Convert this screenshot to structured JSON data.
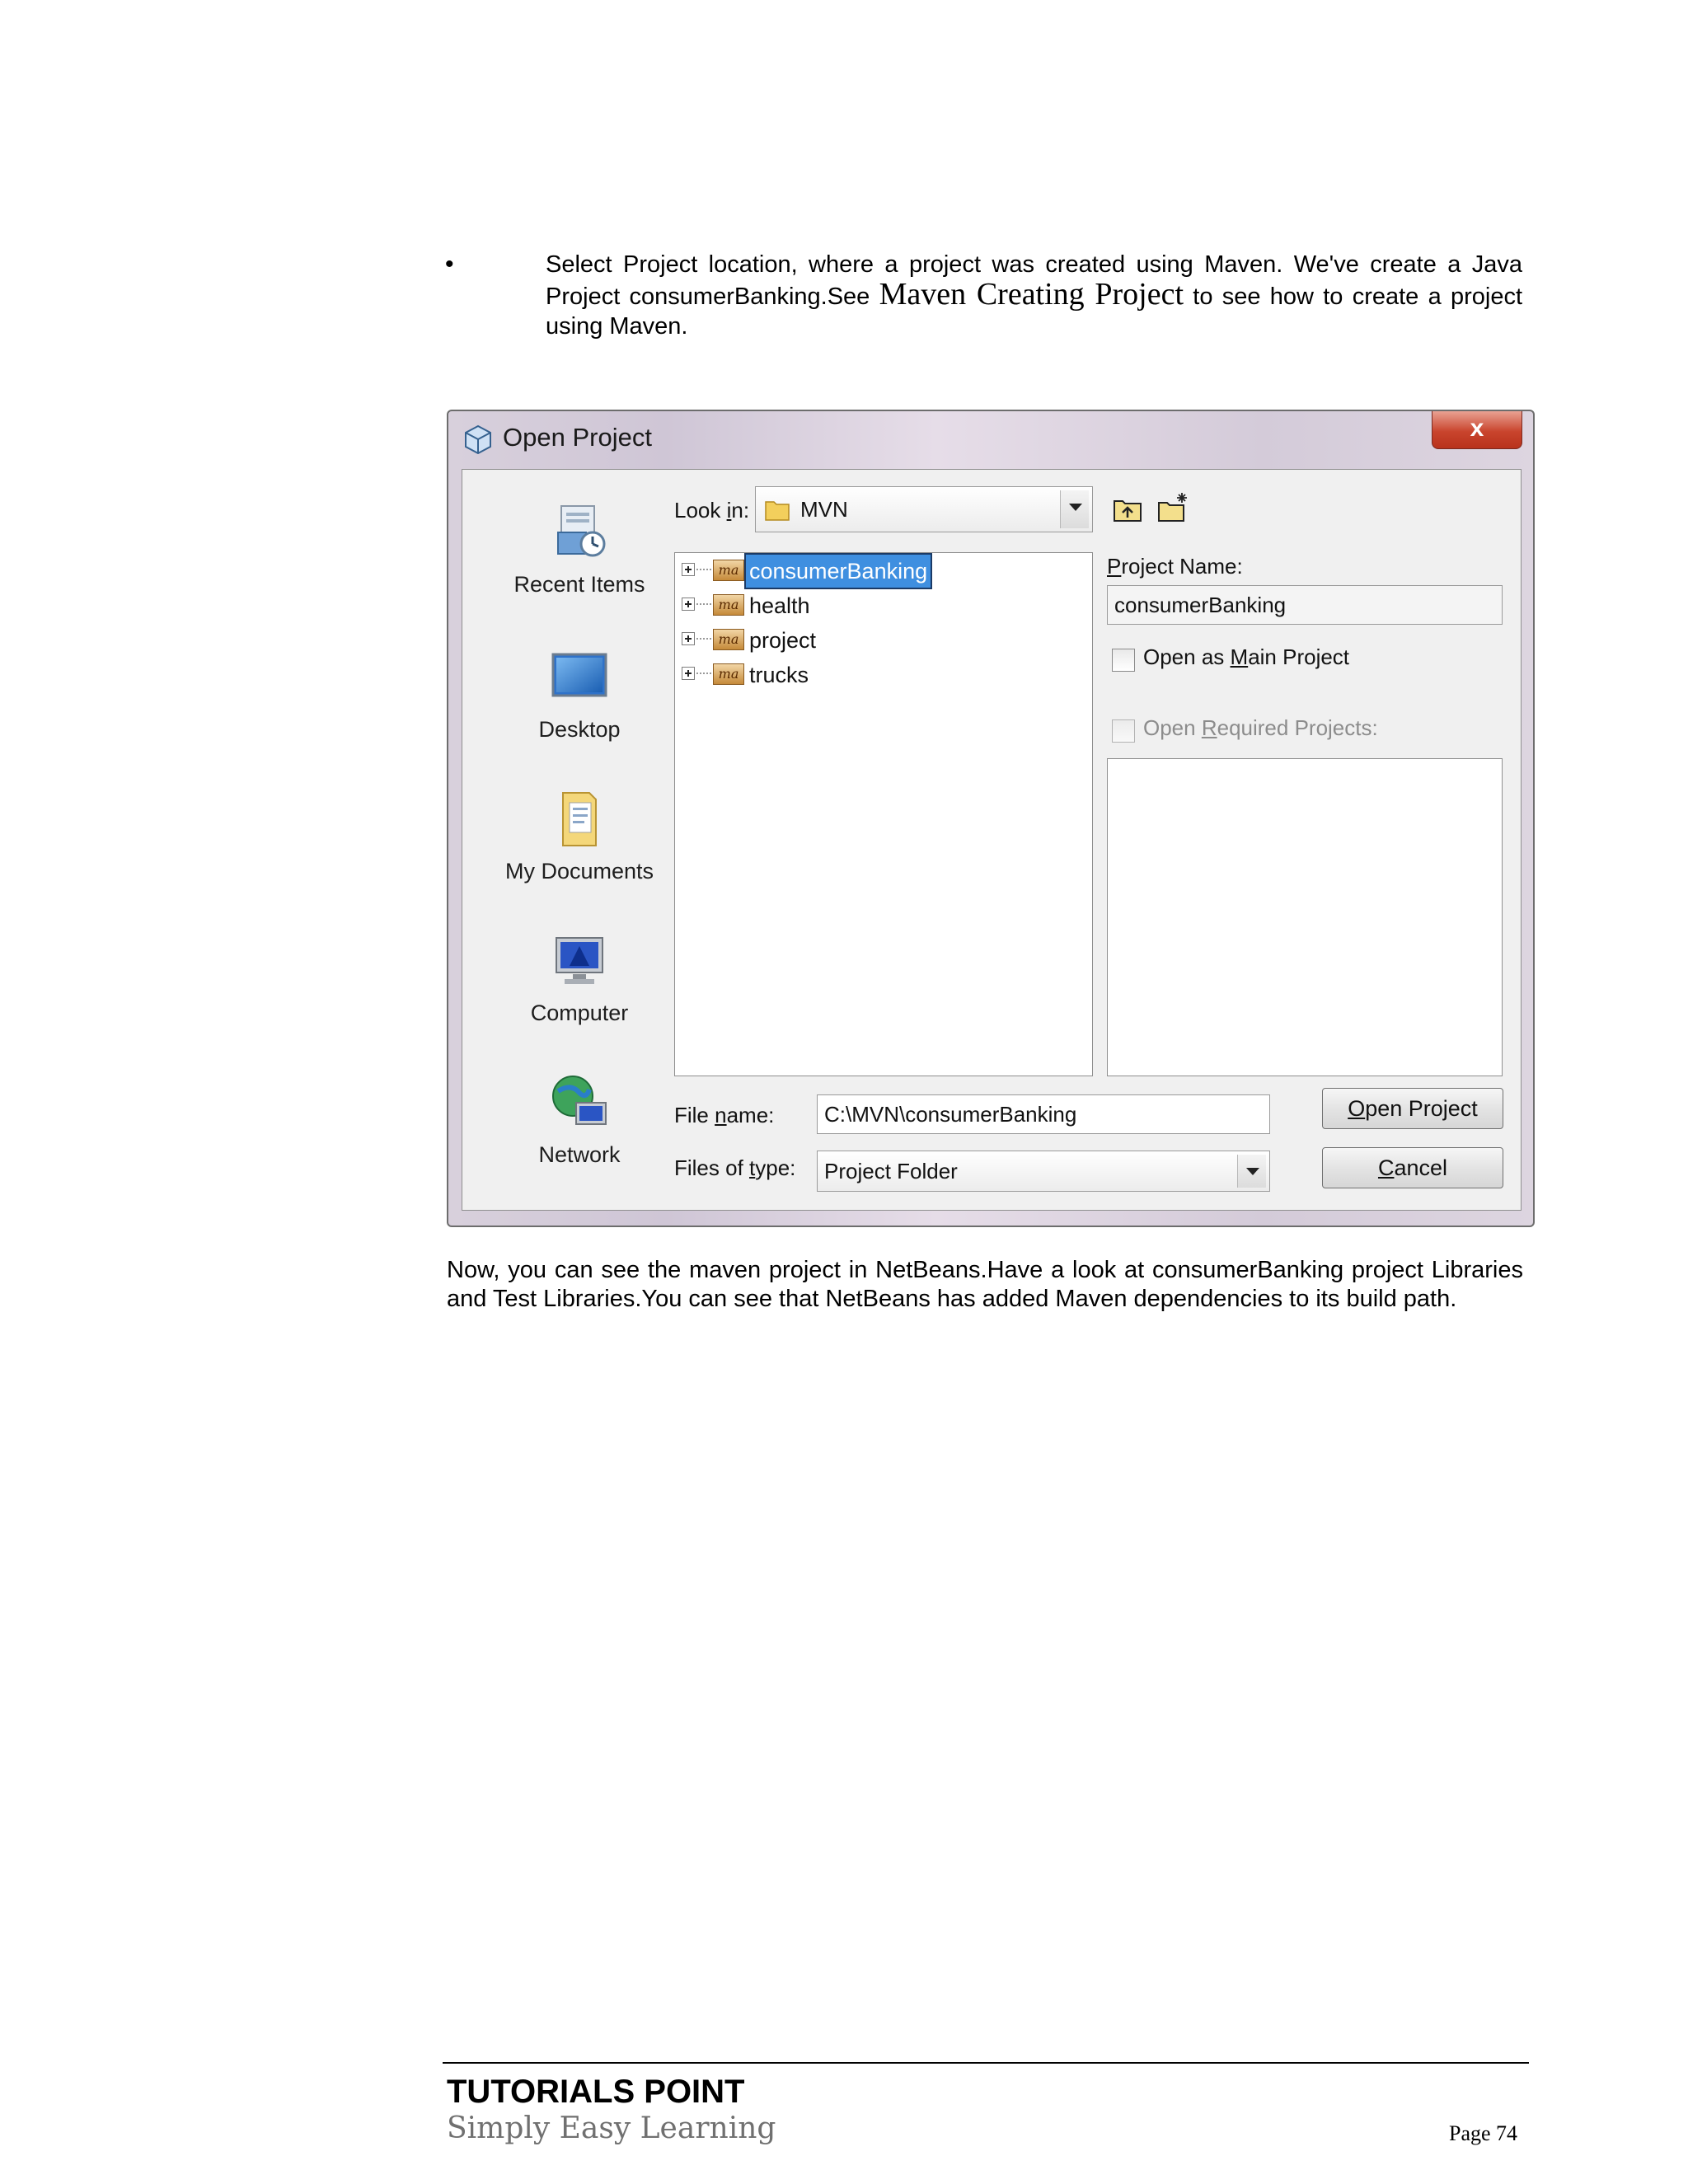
{
  "intro": {
    "bullet": "•",
    "text_before": "Select Project location, where a project was created using Maven. We've create a Java Project consumerBanking.See ",
    "link_text": "Maven Creating Project",
    "text_after": " to see how to create a project using Maven."
  },
  "dialog": {
    "title": "Open Project",
    "close_label": "x",
    "places": [
      {
        "label": "Recent Items",
        "icon": "recent-items-icon"
      },
      {
        "label": "Desktop",
        "icon": "desktop-icon"
      },
      {
        "label": "My Documents",
        "icon": "documents-folder-icon"
      },
      {
        "label": "Computer",
        "icon": "computer-icon"
      },
      {
        "label": "Network",
        "icon": "network-icon"
      }
    ],
    "look_in": {
      "label_pre": "Look ",
      "label_u": "i",
      "label_post": "n:",
      "value": "MVN"
    },
    "tree_items": [
      "consumerBanking",
      "health",
      "project",
      "trucks"
    ],
    "selected_item": "consumerBanking",
    "project_name": {
      "label_u": "P",
      "label_post": "roject Name:",
      "value": "consumerBanking"
    },
    "open_as_main": {
      "pre": "Open as ",
      "u": "M",
      "post": "ain Project",
      "checked": false
    },
    "open_required": {
      "pre": "Open ",
      "u": "R",
      "post": "equired Projects:",
      "checked": false,
      "enabled": false
    },
    "file_name": {
      "pre": "File ",
      "u": "n",
      "post": "ame:",
      "value": "C:\\MVN\\consumerBanking"
    },
    "files_of_type": {
      "pre": "Files of ",
      "u": "t",
      "post": "ype:",
      "value": "Project Folder"
    },
    "open_button": {
      "u": "O",
      "post": "pen Project"
    },
    "cancel_button": {
      "u": "C",
      "post": "ancel"
    }
  },
  "outro": {
    "text": "Now, you can see the maven project in NetBeans.Have a look at consumerBanking project Libraries and Test Libraries.You can see that NetBeans has added Maven dependencies to its build path."
  },
  "footer": {
    "brand": "TUTORIALS POINT",
    "tagline": "Simply Easy Learning",
    "page": "Page 74"
  }
}
